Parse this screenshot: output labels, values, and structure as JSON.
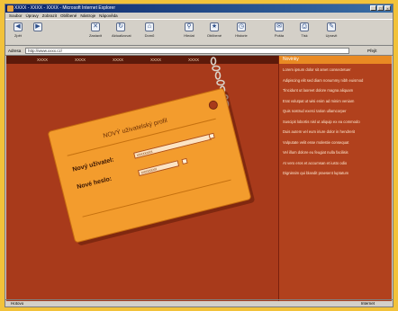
{
  "window": {
    "title": "XXXX - XXXX - XXXX - Microsoft Internet Explorer",
    "buttons": [
      "_",
      "□",
      "×"
    ]
  },
  "menu": [
    "Soubor",
    "Úpravy",
    "Zobrazit",
    "Oblíbené",
    "Nástroje",
    "Nápověda"
  ],
  "toolbar": [
    {
      "label": "Zpět",
      "icon": "back-arrow-icon"
    },
    {
      "label": "",
      "icon": "forward-arrow-icon"
    },
    {
      "label": "Zastavit",
      "icon": "stop-icon"
    },
    {
      "label": "Aktualizovat",
      "icon": "refresh-icon"
    },
    {
      "label": "Domů",
      "icon": "home-icon"
    },
    {
      "label": "Hledat",
      "icon": "search-icon"
    },
    {
      "label": "Oblíbené",
      "icon": "favorites-icon"
    },
    {
      "label": "Historie",
      "icon": "history-icon"
    },
    {
      "label": "Pošta",
      "icon": "mail-icon"
    },
    {
      "label": "Tisk",
      "icon": "print-icon"
    },
    {
      "label": "Upravit",
      "icon": "edit-icon"
    }
  ],
  "address": {
    "label": "Adresa",
    "value": "http://www.xxxx.cz/",
    "go": "Přejít"
  },
  "site": {
    "nav": [
      "XXXX",
      "XXXX",
      "XXXX",
      "XXXX",
      "XXXX"
    ],
    "form": {
      "title": "NOVÝ uživatelský profil",
      "row1_label": "Nový uživatel:",
      "row1_value": "xxxxxxxx",
      "row2_label": "Nové heslo:",
      "row2_value": "xxxxxxxx"
    },
    "side": {
      "header": "Novinky",
      "items": [
        {
          "text": "Lorem ipsum dolor sit amet consectetuer",
          "date": ""
        },
        {
          "text": "Adipiscing elit sed diam nonummy nibh euismod",
          "date": ""
        },
        {
          "text": "Tincidunt ut laoreet dolore magna aliquam",
          "date": ""
        },
        {
          "text": "Erat volutpat ut wisi enim ad minim veniam",
          "date": ""
        },
        {
          "text": "Quis nostrud exerci tation ullamcorper",
          "date": ""
        },
        {
          "text": "Suscipit lobortis nisl ut aliquip ex ea commodo",
          "date": ""
        },
        {
          "text": "Duis autem vel eum iriure dolor in hendrerit",
          "date": ""
        },
        {
          "text": "Vulputate velit esse molestie consequat",
          "date": ""
        },
        {
          "text": "Vel illum dolore eu feugiat nulla facilisis",
          "date": ""
        },
        {
          "text": "At vero eros et accumsan et iusto odio",
          "date": ""
        },
        {
          "text": "Dignissim qui blandit praesent luptatum",
          "date": ""
        }
      ]
    }
  },
  "status": {
    "left": "Hotovo",
    "right": "Internet"
  }
}
